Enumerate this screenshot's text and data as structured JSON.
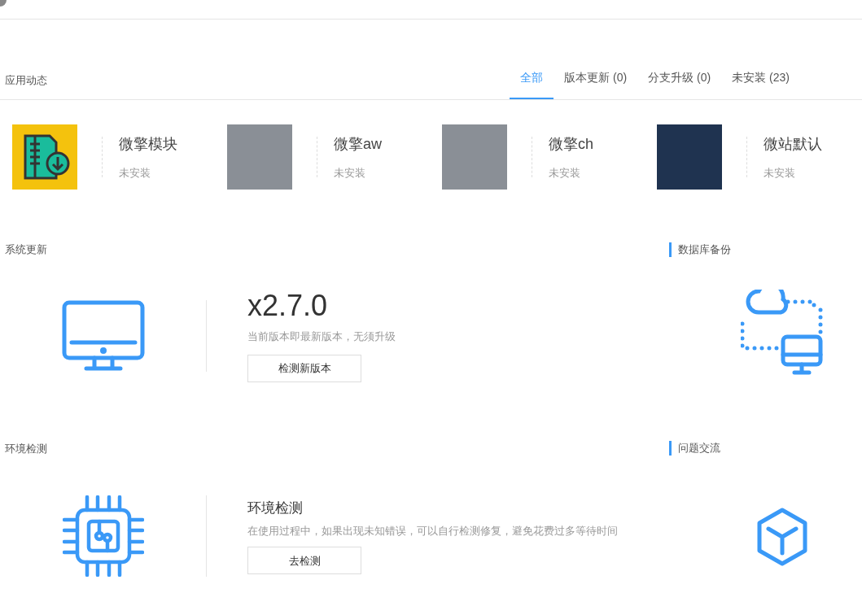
{
  "header": {
    "title": "应用动态"
  },
  "tabs": [
    {
      "label": "全部",
      "selected": true
    },
    {
      "label": "版本更新 (0)",
      "selected": false
    },
    {
      "label": "分支升级 (0)",
      "selected": false
    },
    {
      "label": "未安装 (23)",
      "selected": false
    }
  ],
  "apps": [
    {
      "kind": "icon",
      "name": "微擎模块",
      "status": "未安装"
    },
    {
      "kind": "screenshot",
      "name": "微擎aw",
      "status": "未安装"
    },
    {
      "kind": "screenshot",
      "name": "微擎ch",
      "status": "未安装"
    },
    {
      "kind": "photo",
      "name": "微站默认",
      "status": "未安装"
    }
  ],
  "system_update": {
    "title": "系统更新",
    "version": "x2.7.0",
    "note": "当前版本即最新版本，无须升级",
    "button": "检测新版本"
  },
  "db_backup": {
    "title": "数据库备份"
  },
  "env_check": {
    "title": "环境检测",
    "heading": "环境检测",
    "description": "在使用过程中，如果出现未知错误，可以自行检测修复，避免花费过多等待时间",
    "button": "去检测"
  },
  "feedback": {
    "title": "问题交流"
  }
}
